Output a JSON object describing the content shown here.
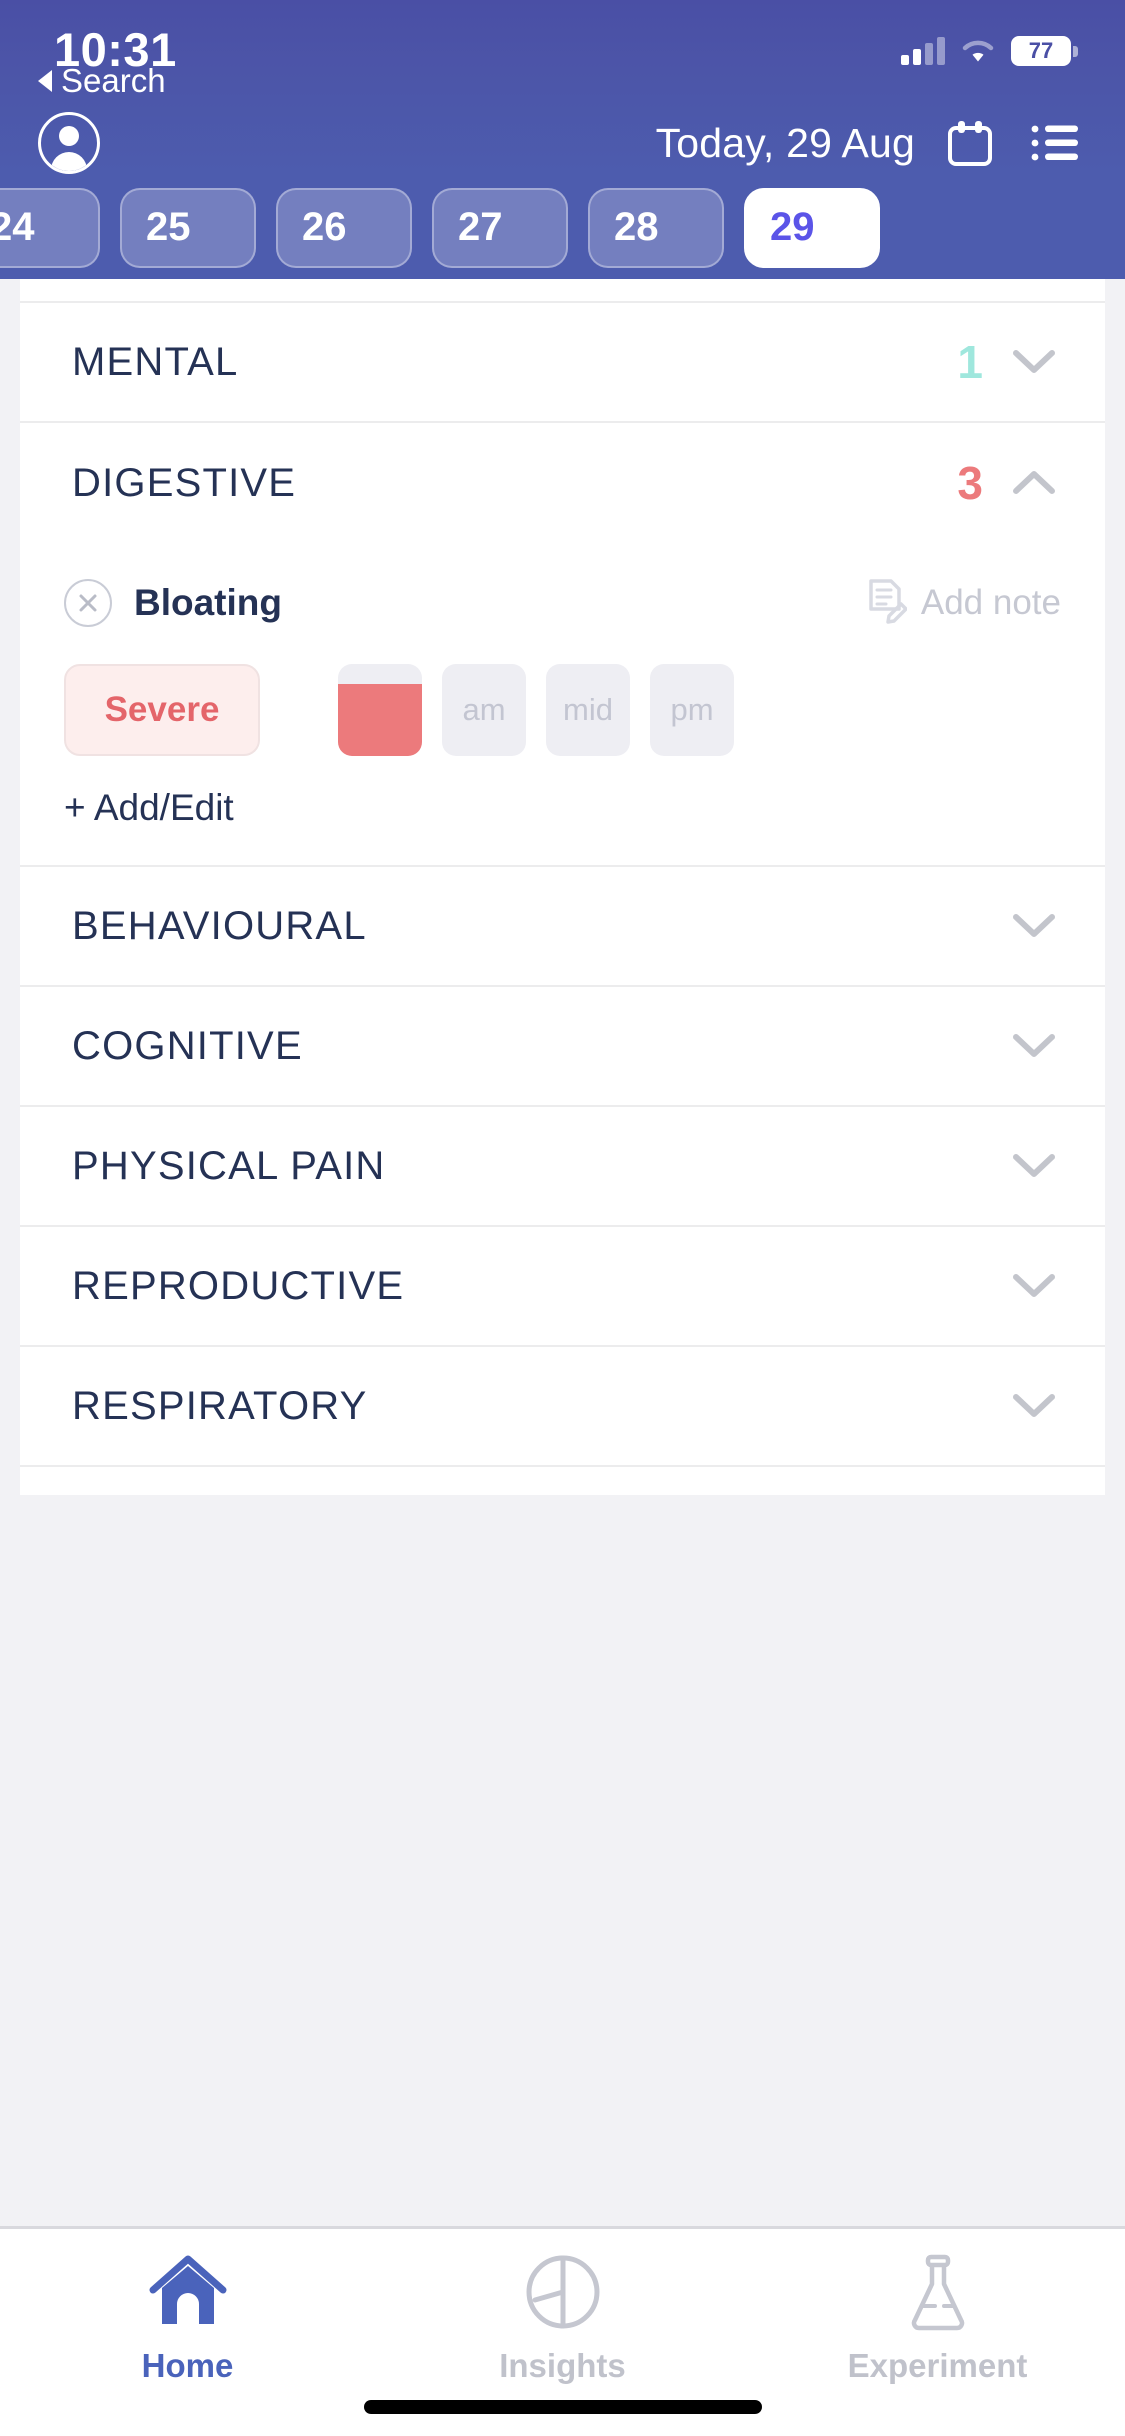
{
  "status_bar": {
    "time": "10:31",
    "battery_percent": "77",
    "signal_icon": "cellular-signal-icon",
    "wifi_icon": "wifi-icon",
    "battery_icon": "battery-icon"
  },
  "back_link": {
    "label": "Search",
    "icon": "back-triangle-icon"
  },
  "header": {
    "title": "Today, 29 Aug",
    "avatar_icon": "profile-avatar-icon",
    "calendar_icon": "calendar-icon",
    "list_icon": "list-icon"
  },
  "date_strip": {
    "days": [
      {
        "label": "24",
        "selected": false,
        "partial": true
      },
      {
        "label": "25",
        "selected": false,
        "partial": false
      },
      {
        "label": "26",
        "selected": false,
        "partial": false
      },
      {
        "label": "27",
        "selected": false,
        "partial": false
      },
      {
        "label": "28",
        "selected": false,
        "partial": false
      },
      {
        "label": "29",
        "selected": true,
        "partial": false
      }
    ]
  },
  "categories": [
    {
      "name": "MENTAL",
      "count": "1",
      "count_color": "#9fe7dd",
      "expanded": false,
      "chevron": "chevron-down-icon"
    },
    {
      "name": "DIGESTIVE",
      "count": "3",
      "count_color": "#ec7a7c",
      "expanded": true,
      "chevron": "chevron-up-icon"
    },
    {
      "name": "BEHAVIOURAL",
      "count": "",
      "count_color": "",
      "expanded": false,
      "chevron": "chevron-down-icon"
    },
    {
      "name": "COGNITIVE",
      "count": "",
      "count_color": "",
      "expanded": false,
      "chevron": "chevron-down-icon"
    },
    {
      "name": "PHYSICAL PAIN",
      "count": "",
      "count_color": "",
      "expanded": false,
      "chevron": "chevron-down-icon"
    },
    {
      "name": "REPRODUCTIVE",
      "count": "",
      "count_color": "",
      "expanded": false,
      "chevron": "chevron-down-icon"
    },
    {
      "name": "RESPIRATORY",
      "count": "",
      "count_color": "",
      "expanded": false,
      "chevron": "chevron-down-icon"
    }
  ],
  "digestive_detail": {
    "symptom_name": "Bloating",
    "remove_icon": "x-circle-icon",
    "note_icon": "note-edit-icon",
    "note_label": "Add note",
    "severity_label": "Severe",
    "severity_color": "#e4656a",
    "time_slots": [
      {
        "label": "",
        "filled": true,
        "fill_percent": 78
      },
      {
        "label": "am",
        "filled": false,
        "fill_percent": 0
      },
      {
        "label": "mid",
        "filled": false,
        "fill_percent": 0
      },
      {
        "label": "pm",
        "filled": false,
        "fill_percent": 0
      }
    ],
    "add_edit_label": "+ Add/Edit"
  },
  "tab_bar": {
    "tabs": [
      {
        "label": "Home",
        "icon": "home-icon",
        "active": true
      },
      {
        "label": "Insights",
        "icon": "pie-chart-icon",
        "active": false
      },
      {
        "label": "Experiment",
        "icon": "flask-icon",
        "active": false
      }
    ]
  }
}
